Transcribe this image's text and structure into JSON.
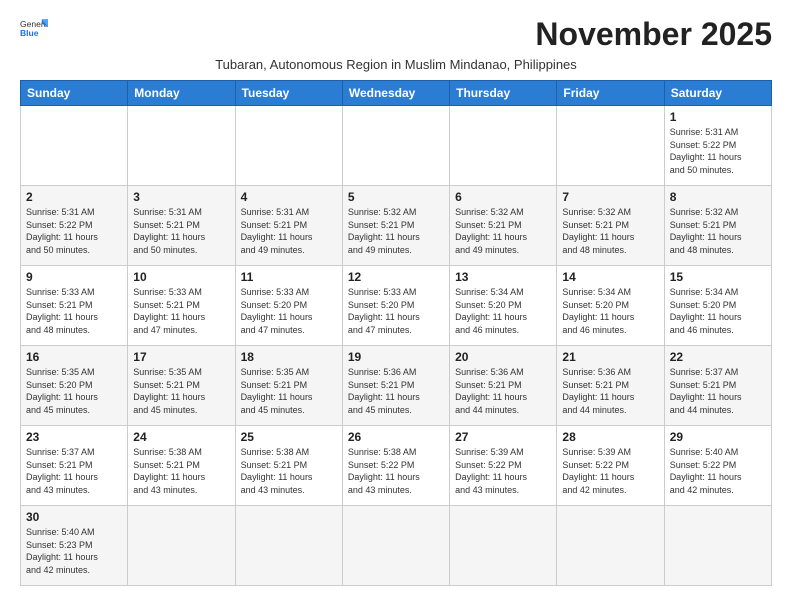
{
  "app": {
    "logo_general": "General",
    "logo_blue": "Blue"
  },
  "title": "November 2025",
  "subtitle": "Tubaran, Autonomous Region in Muslim Mindanao, Philippines",
  "days_of_week": [
    "Sunday",
    "Monday",
    "Tuesday",
    "Wednesday",
    "Thursday",
    "Friday",
    "Saturday"
  ],
  "weeks": [
    [
      {
        "day": "",
        "info": ""
      },
      {
        "day": "",
        "info": ""
      },
      {
        "day": "",
        "info": ""
      },
      {
        "day": "",
        "info": ""
      },
      {
        "day": "",
        "info": ""
      },
      {
        "day": "",
        "info": ""
      },
      {
        "day": "1",
        "info": "Sunrise: 5:31 AM\nSunset: 5:22 PM\nDaylight: 11 hours\nand 50 minutes."
      }
    ],
    [
      {
        "day": "2",
        "info": "Sunrise: 5:31 AM\nSunset: 5:22 PM\nDaylight: 11 hours\nand 50 minutes."
      },
      {
        "day": "3",
        "info": "Sunrise: 5:31 AM\nSunset: 5:21 PM\nDaylight: 11 hours\nand 50 minutes."
      },
      {
        "day": "4",
        "info": "Sunrise: 5:31 AM\nSunset: 5:21 PM\nDaylight: 11 hours\nand 49 minutes."
      },
      {
        "day": "5",
        "info": "Sunrise: 5:32 AM\nSunset: 5:21 PM\nDaylight: 11 hours\nand 49 minutes."
      },
      {
        "day": "6",
        "info": "Sunrise: 5:32 AM\nSunset: 5:21 PM\nDaylight: 11 hours\nand 49 minutes."
      },
      {
        "day": "7",
        "info": "Sunrise: 5:32 AM\nSunset: 5:21 PM\nDaylight: 11 hours\nand 48 minutes."
      },
      {
        "day": "8",
        "info": "Sunrise: 5:32 AM\nSunset: 5:21 PM\nDaylight: 11 hours\nand 48 minutes."
      }
    ],
    [
      {
        "day": "9",
        "info": "Sunrise: 5:33 AM\nSunset: 5:21 PM\nDaylight: 11 hours\nand 48 minutes."
      },
      {
        "day": "10",
        "info": "Sunrise: 5:33 AM\nSunset: 5:21 PM\nDaylight: 11 hours\nand 47 minutes."
      },
      {
        "day": "11",
        "info": "Sunrise: 5:33 AM\nSunset: 5:20 PM\nDaylight: 11 hours\nand 47 minutes."
      },
      {
        "day": "12",
        "info": "Sunrise: 5:33 AM\nSunset: 5:20 PM\nDaylight: 11 hours\nand 47 minutes."
      },
      {
        "day": "13",
        "info": "Sunrise: 5:34 AM\nSunset: 5:20 PM\nDaylight: 11 hours\nand 46 minutes."
      },
      {
        "day": "14",
        "info": "Sunrise: 5:34 AM\nSunset: 5:20 PM\nDaylight: 11 hours\nand 46 minutes."
      },
      {
        "day": "15",
        "info": "Sunrise: 5:34 AM\nSunset: 5:20 PM\nDaylight: 11 hours\nand 46 minutes."
      }
    ],
    [
      {
        "day": "16",
        "info": "Sunrise: 5:35 AM\nSunset: 5:20 PM\nDaylight: 11 hours\nand 45 minutes."
      },
      {
        "day": "17",
        "info": "Sunrise: 5:35 AM\nSunset: 5:21 PM\nDaylight: 11 hours\nand 45 minutes."
      },
      {
        "day": "18",
        "info": "Sunrise: 5:35 AM\nSunset: 5:21 PM\nDaylight: 11 hours\nand 45 minutes."
      },
      {
        "day": "19",
        "info": "Sunrise: 5:36 AM\nSunset: 5:21 PM\nDaylight: 11 hours\nand 45 minutes."
      },
      {
        "day": "20",
        "info": "Sunrise: 5:36 AM\nSunset: 5:21 PM\nDaylight: 11 hours\nand 44 minutes."
      },
      {
        "day": "21",
        "info": "Sunrise: 5:36 AM\nSunset: 5:21 PM\nDaylight: 11 hours\nand 44 minutes."
      },
      {
        "day": "22",
        "info": "Sunrise: 5:37 AM\nSunset: 5:21 PM\nDaylight: 11 hours\nand 44 minutes."
      }
    ],
    [
      {
        "day": "23",
        "info": "Sunrise: 5:37 AM\nSunset: 5:21 PM\nDaylight: 11 hours\nand 43 minutes."
      },
      {
        "day": "24",
        "info": "Sunrise: 5:38 AM\nSunset: 5:21 PM\nDaylight: 11 hours\nand 43 minutes."
      },
      {
        "day": "25",
        "info": "Sunrise: 5:38 AM\nSunset: 5:21 PM\nDaylight: 11 hours\nand 43 minutes."
      },
      {
        "day": "26",
        "info": "Sunrise: 5:38 AM\nSunset: 5:22 PM\nDaylight: 11 hours\nand 43 minutes."
      },
      {
        "day": "27",
        "info": "Sunrise: 5:39 AM\nSunset: 5:22 PM\nDaylight: 11 hours\nand 43 minutes."
      },
      {
        "day": "28",
        "info": "Sunrise: 5:39 AM\nSunset: 5:22 PM\nDaylight: 11 hours\nand 42 minutes."
      },
      {
        "day": "29",
        "info": "Sunrise: 5:40 AM\nSunset: 5:22 PM\nDaylight: 11 hours\nand 42 minutes."
      }
    ],
    [
      {
        "day": "30",
        "info": "Sunrise: 5:40 AM\nSunset: 5:23 PM\nDaylight: 11 hours\nand 42 minutes."
      },
      {
        "day": "",
        "info": ""
      },
      {
        "day": "",
        "info": ""
      },
      {
        "day": "",
        "info": ""
      },
      {
        "day": "",
        "info": ""
      },
      {
        "day": "",
        "info": ""
      },
      {
        "day": "",
        "info": ""
      }
    ]
  ]
}
